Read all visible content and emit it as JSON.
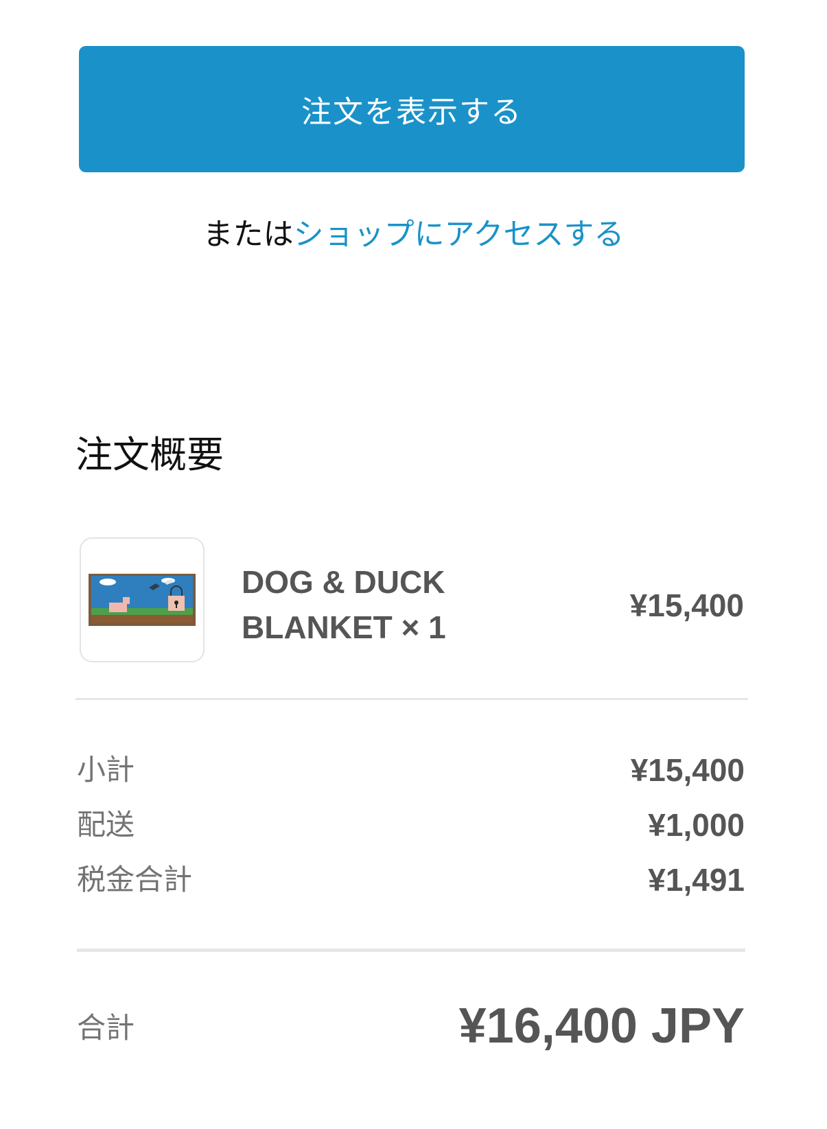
{
  "actions": {
    "view_order_label": "注文を表示する",
    "or_text": "または",
    "shop_link_label": "ショップにアクセスする"
  },
  "summary": {
    "title": "注文概要",
    "item": {
      "name_line1": "DOG & DUCK",
      "name_line2": "BLANKET × 1",
      "price": "¥15,400",
      "image_icon": "blanket-thumbnail"
    },
    "lines": [
      {
        "label": "小計",
        "value": "¥15,400"
      },
      {
        "label": "配送",
        "value": "¥1,000"
      },
      {
        "label": "税金合計",
        "value": "¥1,491"
      }
    ],
    "total": {
      "label": "合計",
      "value": "¥16,400 JPY"
    }
  },
  "colors": {
    "accent": "#1a92c9",
    "text_strong": "#555555",
    "text_muted": "#737373",
    "divider": "#e6e6e6"
  }
}
